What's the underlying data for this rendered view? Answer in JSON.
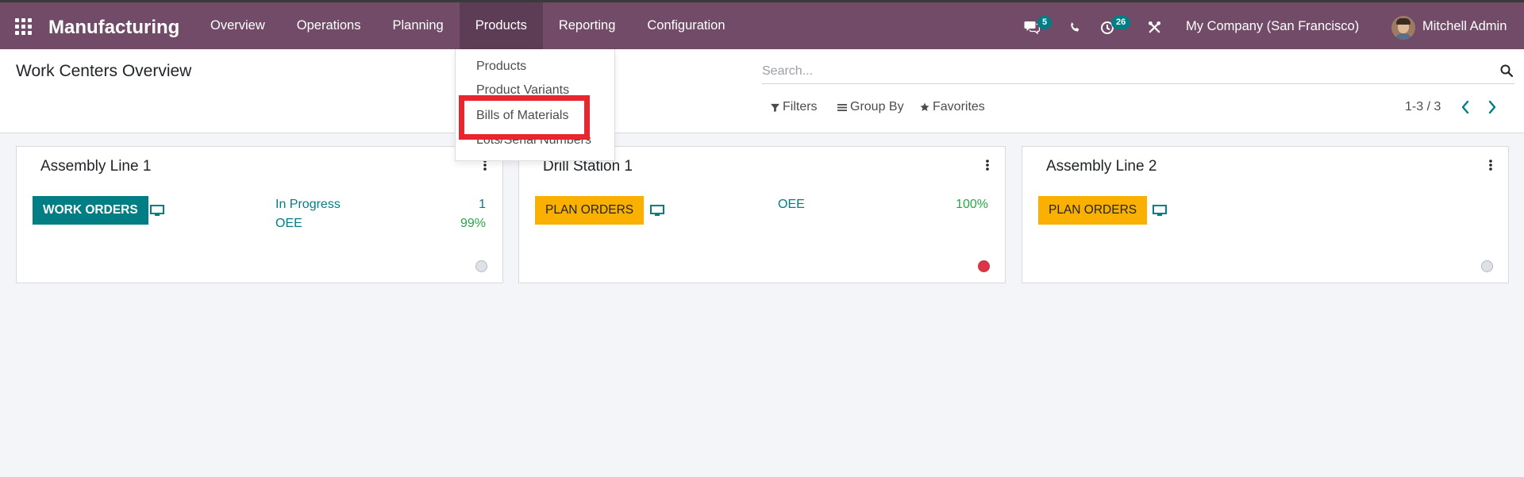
{
  "navbar": {
    "app_name": "Manufacturing",
    "menu": [
      "Overview",
      "Operations",
      "Planning",
      "Products",
      "Reporting",
      "Configuration"
    ],
    "active_menu": "Products",
    "messages_badge": "5",
    "activities_badge": "26",
    "company": "My Company (San Francisco)",
    "user": "Mitchell Admin"
  },
  "control_panel": {
    "title": "Work Centers Overview",
    "search_placeholder": "Search...",
    "filters_label": "Filters",
    "group_by_label": "Group By",
    "favorites_label": "Favorites",
    "pager": "1-3 / 3"
  },
  "products_dropdown": {
    "items": [
      "Products",
      "Product Variants",
      "Bills of Materials",
      "Lots/Serial Numbers"
    ],
    "highlighted": "Bills of Materials"
  },
  "cards": [
    {
      "title": "Assembly Line 1",
      "button": "WORK ORDERS",
      "button_style": "teal",
      "stats": [
        {
          "label": "In Progress",
          "value": "1"
        },
        {
          "label": "OEE",
          "value": "99%"
        }
      ],
      "status_color": "#dee2e6"
    },
    {
      "title": "Drill Station 1",
      "button": "PLAN ORDERS",
      "button_style": "yellow",
      "stats": [
        {
          "label": "OEE",
          "value": "100%"
        }
      ],
      "status_color": "#dc3545"
    },
    {
      "title": "Assembly Line 2",
      "button": "PLAN ORDERS",
      "button_style": "yellow",
      "stats": [],
      "status_color": "#dee2e6"
    }
  ],
  "colors": {
    "navbar": "#714b67",
    "accent_teal": "#017e84",
    "plan_yellow": "#f9b000",
    "ok_green": "#28a745",
    "highlight_red": "#e8262e"
  }
}
